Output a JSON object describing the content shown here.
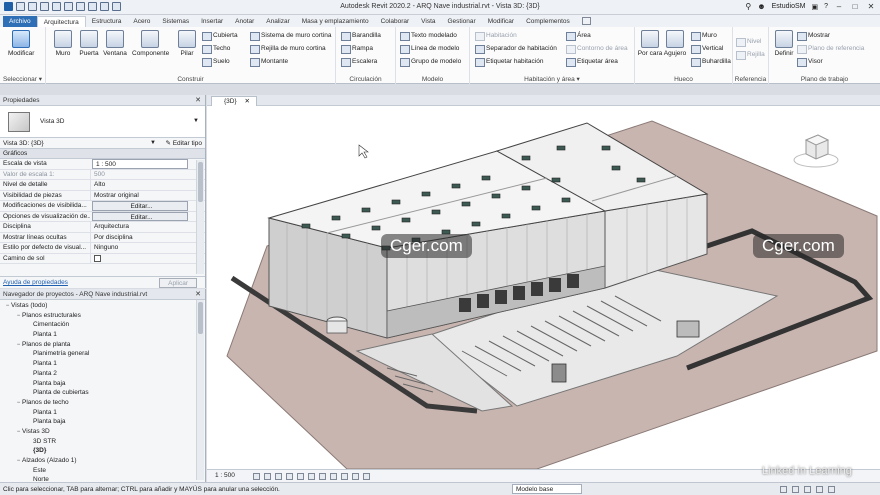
{
  "app": {
    "title": "Autodesk Revit 2020.2 - ARQ Nave industrial.rvt - Vista 3D: {3D}",
    "user": "EstudioSM"
  },
  "tabs": [
    "Archivo",
    "Arquitectura",
    "Estructura",
    "Acero",
    "Sistemas",
    "Insertar",
    "Anotar",
    "Analizar",
    "Masa y emplazamiento",
    "Colaborar",
    "Vista",
    "Gestionar",
    "Modificar",
    "Complementos"
  ],
  "active_tab": "Arquitectura",
  "ribbon": {
    "select": {
      "modify": "Modificar",
      "label": "Seleccionar ▾"
    },
    "build": {
      "label": "Construir",
      "wall": "Muro",
      "door": "Puerta",
      "window": "Ventana",
      "component": "Componente",
      "column": "Pilar",
      "roof": "Cubierta",
      "ceiling": "Techo",
      "floor": "Suelo",
      "curtain_system": "Sistema de muro cortina",
      "curtain_grid": "Rejilla de muro cortina",
      "mullion": "Montante"
    },
    "circulation": {
      "label": "Circulación",
      "railing": "Barandilla",
      "ramp": "Rampa",
      "stair": "Escalera"
    },
    "model": {
      "label": "Modelo",
      "model_text": "Texto modelado",
      "model_line": "Línea de modelo",
      "model_group": "Grupo de modelo"
    },
    "room": {
      "label": "Habitación y área ▾",
      "room": "Habitación",
      "separator": "Separador de habitación",
      "tag_room": "Etiquetar  habitación",
      "area": "Área",
      "area_boundary": "Contorno de área",
      "tag_area": "Etiquetar área"
    },
    "opening": {
      "label": "Hueco",
      "by_face": "Por cara",
      "shaft": "Agujero",
      "wall": "Muro",
      "vertical": "Vertical",
      "dormer": "Buhardilla"
    },
    "datum": {
      "label": "Referencia",
      "level": "Nivel",
      "grid": "Rejilla"
    },
    "workplane": {
      "label": "Plano de trabajo",
      "set": "Definir",
      "show": "Mostrar",
      "ref_plane": "Plano de referencia",
      "viewer": "Visor"
    }
  },
  "properties": {
    "header": "Propiedades",
    "type_name": "Vista 3D",
    "selector": "Vista 3D: {3D}",
    "edit_type": "Editar tipo",
    "category": "Gráficos",
    "rows": [
      {
        "k": "Escala de vista",
        "v": "1 : 500"
      },
      {
        "k": "Valor de escala    1:",
        "v": "500"
      },
      {
        "k": "Nivel de detalle",
        "v": "Alto"
      },
      {
        "k": "Visibilidad de piezas",
        "v": "Mostrar original"
      },
      {
        "k": "Modificaciones de visibilida...",
        "v": "Editar..."
      },
      {
        "k": "Opciones de visualización de...",
        "v": "Editar..."
      },
      {
        "k": "Disciplina",
        "v": "Arquitectura"
      },
      {
        "k": "Mostrar líneas ocultas",
        "v": "Por disciplina"
      },
      {
        "k": "Estilo por defecto de visual...",
        "v": "Ninguno"
      },
      {
        "k": "Camino de sol",
        "v": ""
      }
    ],
    "help": "Ayuda de propiedades",
    "apply": "Aplicar"
  },
  "browser": {
    "header": "Navegador de proyectos - ARQ Nave industrial.rvt",
    "items": [
      {
        "t": "Vistas (todo)",
        "lvl": 0,
        "tg": "−"
      },
      {
        "t": "Planos estructurales",
        "lvl": 1,
        "tg": "−"
      },
      {
        "t": "Cimentación",
        "lvl": 2,
        "tg": ""
      },
      {
        "t": "Planta 1",
        "lvl": 2,
        "tg": ""
      },
      {
        "t": "Planos de planta",
        "lvl": 1,
        "tg": "−"
      },
      {
        "t": "Planimetría general",
        "lvl": 2,
        "tg": ""
      },
      {
        "t": "Planta 1",
        "lvl": 2,
        "tg": ""
      },
      {
        "t": "Planta 2",
        "lvl": 2,
        "tg": ""
      },
      {
        "t": "Planta baja",
        "lvl": 2,
        "tg": ""
      },
      {
        "t": "Planta de cubiertas",
        "lvl": 2,
        "tg": ""
      },
      {
        "t": "Planos de techo",
        "lvl": 1,
        "tg": "−"
      },
      {
        "t": "Planta 1",
        "lvl": 2,
        "tg": ""
      },
      {
        "t": "Planta baja",
        "lvl": 2,
        "tg": ""
      },
      {
        "t": "Vistas 3D",
        "lvl": 1,
        "tg": "−"
      },
      {
        "t": "3D STR",
        "lvl": 2,
        "tg": ""
      },
      {
        "t": "{3D}",
        "lvl": 2,
        "tg": "",
        "bold": true
      },
      {
        "t": "Alzados (Alzado 1)",
        "lvl": 1,
        "tg": "−"
      },
      {
        "t": "Este",
        "lvl": 2,
        "tg": ""
      },
      {
        "t": "Norte",
        "lvl": 2,
        "tg": ""
      }
    ]
  },
  "view": {
    "tab": "{3D}",
    "scale": "1 : 500",
    "watermark": "Cger.com"
  },
  "status": {
    "message": "Clic para seleccionar, TAB para alternar; CTRL para añadir y MAYÚS para anular una selección.",
    "model": "Modelo base"
  },
  "branding": {
    "linkedin": "Linked in Learning"
  }
}
